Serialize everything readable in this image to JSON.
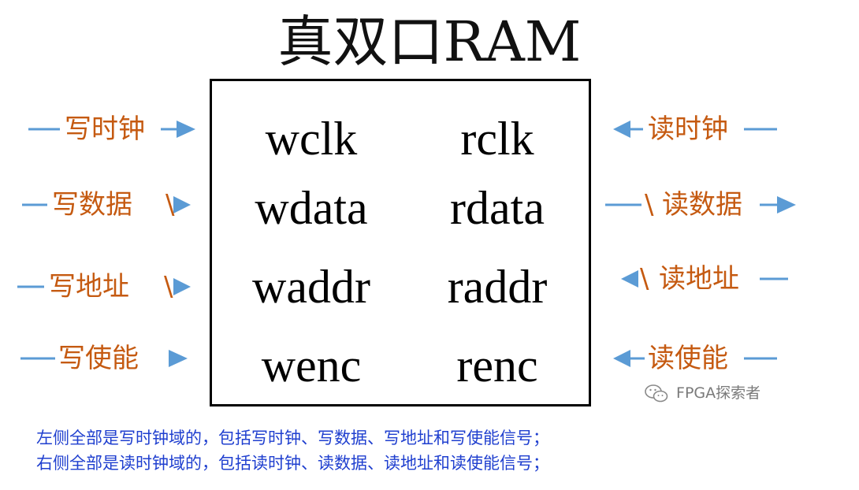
{
  "title": "真双口RAM",
  "ports": {
    "left": [
      "wclk",
      "wdata",
      "waddr",
      "wenc"
    ],
    "right": [
      "rclk",
      "rdata",
      "raddr",
      "renc"
    ]
  },
  "signals": {
    "write": [
      {
        "label": "写时钟",
        "bus": false
      },
      {
        "label": "写数据",
        "bus": true
      },
      {
        "label": "写地址",
        "bus": true
      },
      {
        "label": "写使能",
        "bus": false
      }
    ],
    "read": [
      {
        "label": "读时钟",
        "bus": false,
        "direction": "in"
      },
      {
        "label": "读数据",
        "bus": true,
        "direction": "out"
      },
      {
        "label": "读地址",
        "bus": true,
        "direction": "in"
      },
      {
        "label": "读使能",
        "bus": false,
        "direction": "in"
      }
    ],
    "bus_mark": "\\"
  },
  "watermark": "FPGA探索者",
  "notes": [
    "左侧全部是写时钟域的，包括写时钟、写数据、写地址和写使能信号；",
    "右侧全部是读时钟域的，包括读时钟、读数据、读地址和读使能信号；"
  ],
  "colors": {
    "arrow": "#5b9bd5",
    "label": "#c55a11",
    "notes": "#1f3fcf"
  }
}
